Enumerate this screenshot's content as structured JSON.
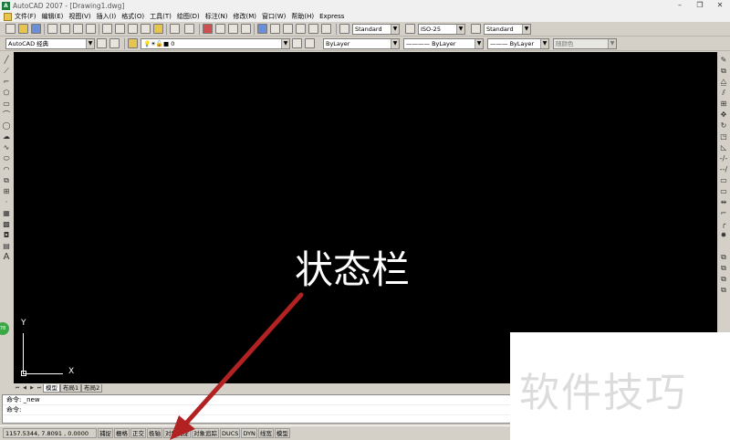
{
  "window": {
    "title": "AutoCAD 2007 - [Drawing1.dwg]",
    "app_icon": "acad-icon"
  },
  "menu": [
    "文件(F)",
    "编辑(E)",
    "视图(V)",
    "插入(I)",
    "格式(O)",
    "工具(T)",
    "绘图(D)",
    "标注(N)",
    "修改(M)",
    "窗口(W)",
    "帮助(H)",
    "Express"
  ],
  "toolbar2": {
    "workspace": "AutoCAD 经典",
    "layer": "0",
    "text_style": "Standard",
    "dim_style": "ISO-25",
    "table_style": "Standard",
    "color": "ByLayer",
    "linetype": "ByLayer",
    "lineweight": "ByLayer",
    "plot_style": "随颜色"
  },
  "drawing": {
    "ucs_y": "Y",
    "ucs_x": "X",
    "annotation": "状态栏",
    "annotation_color": "#ffffff",
    "arrow_color": "#b22222"
  },
  "tabs": [
    "模型",
    "布局1",
    "布局2"
  ],
  "command": {
    "line1": "命令: _new",
    "line2": "命令:"
  },
  "status": {
    "coords": "1157.5344, 7.8091 , 0.0000",
    "buttons": [
      "捕捉",
      "栅格",
      "正交",
      "极轴",
      "对象捕捉",
      "对象追踪",
      "DUCS",
      "DYN",
      "线宽",
      "模型"
    ]
  },
  "watermark": "软件技巧"
}
